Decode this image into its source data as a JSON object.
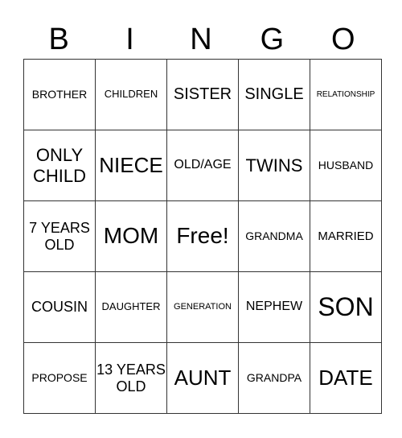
{
  "header": {
    "letters": [
      "B",
      "I",
      "N",
      "G",
      "O"
    ]
  },
  "board": {
    "rows": [
      [
        "BROTHER",
        "CHILDREN",
        "SISTER",
        "SINGLE",
        "RELATIONSHIP"
      ],
      [
        "ONLY CHILD",
        "NIECE",
        "OLD/AGE",
        "TWINS",
        "HUSBAND"
      ],
      [
        "7 YEARS OLD",
        "MOM",
        "Free!",
        "GRANDMA",
        "MARRIED"
      ],
      [
        "COUSIN",
        "DAUGHTER",
        "GENERATION",
        "NEPHEW",
        "SON"
      ],
      [
        "PROPOSE",
        "13 YEARS OLD",
        "AUNT",
        "GRANDPA",
        "DATE"
      ]
    ]
  }
}
